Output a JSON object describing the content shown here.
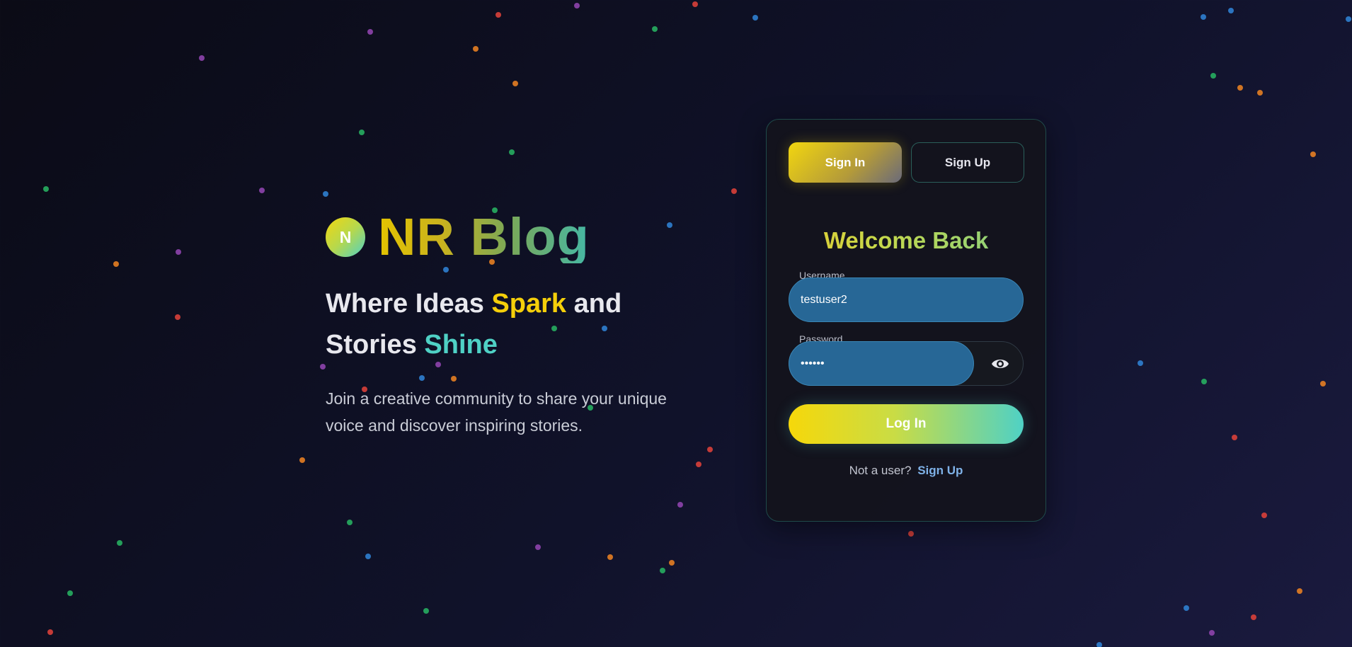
{
  "brand": {
    "logo_letter": "N",
    "name": "NR Blog"
  },
  "hero": {
    "headline_part1": "Where Ideas ",
    "headline_spark": "Spark",
    "headline_part2": " and",
    "headline_part3": "Stories ",
    "headline_shine": "Shine",
    "subtext": "Join a creative community to share your unique voice and discover inspiring stories."
  },
  "auth": {
    "tab_signin": "Sign In",
    "tab_signup": "Sign Up",
    "title": "Welcome Back",
    "username_label": "Username",
    "username_value": "testuser2",
    "password_label": "Password",
    "password_value": "••••••",
    "login_button": "Log In",
    "alt_text": "Not a user?",
    "alt_link": "Sign Up"
  },
  "theme": {
    "accent_yellow": "#f5cf0a",
    "accent_teal": "#4fd1c5",
    "input_blue": "#276796"
  }
}
